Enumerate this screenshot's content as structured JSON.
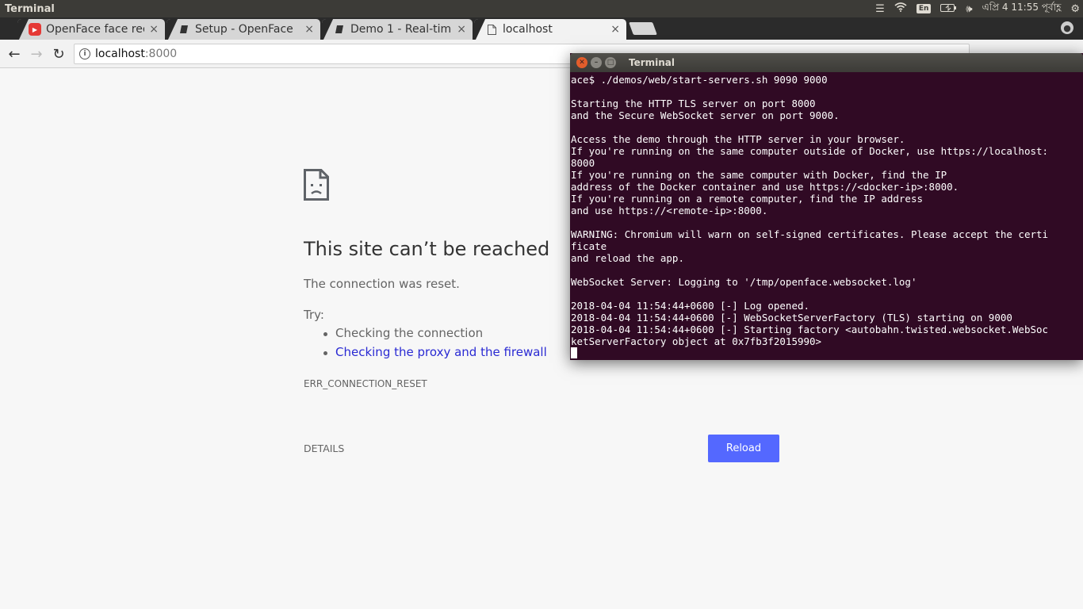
{
  "panel": {
    "app_title": "Terminal",
    "indicators": [
      "menu-icon",
      "wifi-icon",
      "keyboard-layout-icon",
      "battery-icon",
      "volume-icon",
      "settings-icon"
    ],
    "keyboard_layout": "En",
    "clock": "এপ্রি 4 11:55 পূর্বাহ্ণ"
  },
  "browser": {
    "tabs": [
      {
        "title": "OpenFace face reco",
        "icon": "youtube-icon",
        "active": false
      },
      {
        "title": "Setup - OpenFace",
        "icon": "book-icon",
        "active": false
      },
      {
        "title": "Demo 1 - Real-time",
        "icon": "book-icon",
        "active": false
      },
      {
        "title": "localhost",
        "icon": "page-icon",
        "active": true
      }
    ],
    "tab_close_glyph": "×",
    "address": {
      "host": "localhost",
      "port": ":8000"
    }
  },
  "error_page": {
    "title": "This site can’t be reached",
    "subtitle": "The connection was reset.",
    "try_label": "Try:",
    "suggestions": [
      "Checking the connection",
      "Checking the proxy and the firewall"
    ],
    "error_code": "ERR_CONNECTION_RESET",
    "details_label": "DETAILS",
    "reload_label": "Reload",
    "reload_color": "#5468ff",
    "link_color": "#2a2ad3"
  },
  "terminal": {
    "title": "Terminal",
    "background": "#300a24",
    "lines": [
      "ace$ ./demos/web/start-servers.sh 9090 9000",
      "",
      "Starting the HTTP TLS server on port 8000",
      "and the Secure WebSocket server on port 9000.",
      "",
      "Access the demo through the HTTP server in your browser.",
      "If you're running on the same computer outside of Docker, use https://localhost:",
      "8000",
      "If you're running on the same computer with Docker, find the IP",
      "address of the Docker container and use https://<docker-ip>:8000.",
      "If you're running on a remote computer, find the IP address",
      "and use https://<remote-ip>:8000.",
      "",
      "WARNING: Chromium will warn on self-signed certificates. Please accept the certi",
      "ficate",
      "and reload the app.",
      "",
      "WebSocket Server: Logging to '/tmp/openface.websocket.log'",
      "",
      "2018-04-04 11:54:44+0600 [-] Log opened.",
      "2018-04-04 11:54:44+0600 [-] WebSocketServerFactory (TLS) starting on 9000",
      "2018-04-04 11:54:44+0600 [-] Starting factory <autobahn.twisted.websocket.WebSoc",
      "ketServerFactory object at 0x7fb3f2015990>"
    ]
  }
}
